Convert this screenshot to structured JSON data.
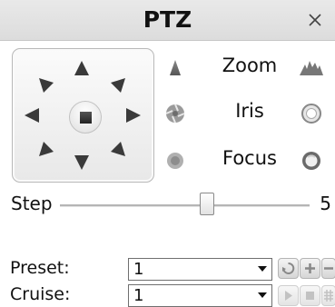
{
  "title": "PTZ",
  "close_symbol": "×",
  "controls": {
    "zoom_label": "Zoom",
    "iris_label": "Iris",
    "focus_label": "Focus"
  },
  "step": {
    "label": "Step",
    "value": "5"
  },
  "preset": {
    "label": "Preset:",
    "selected": "1"
  },
  "cruise": {
    "label": "Cruise:",
    "selected": "1"
  },
  "icons": {
    "directions": [
      "up-left-arrow-icon",
      "up-arrow-icon",
      "up-right-arrow-icon",
      "left-arrow-icon",
      "stop-icon",
      "right-arrow-icon",
      "down-left-arrow-icon",
      "down-arrow-icon",
      "down-right-arrow-icon"
    ],
    "preset_buttons": [
      "call-preset-icon",
      "add-preset-icon",
      "delete-preset-icon"
    ],
    "cruise_buttons": [
      "play-icon",
      "stop-icon",
      "grid-icon"
    ]
  }
}
